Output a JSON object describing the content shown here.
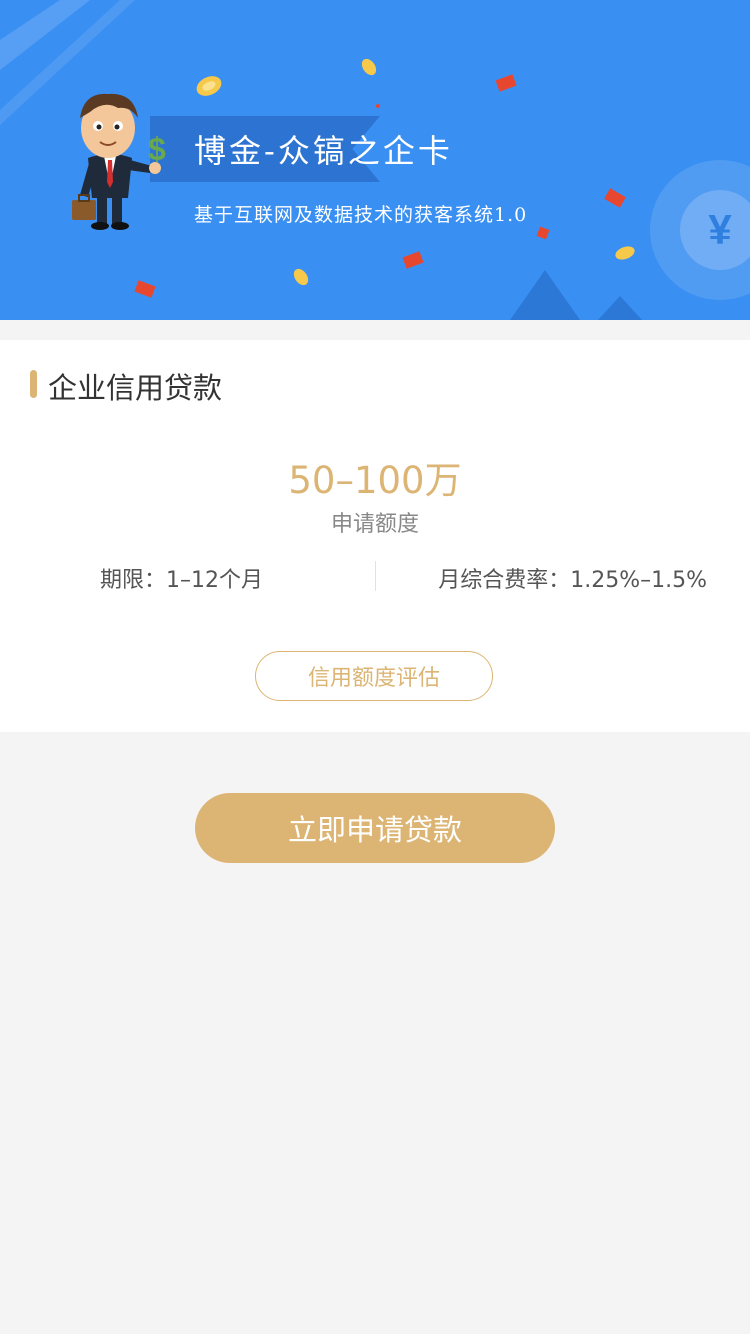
{
  "banner": {
    "title": "博金-众镐之企卡",
    "subtitle": "基于互联网及数据技术的获客系统1.0",
    "dollar_glyph": "$",
    "yen_glyph": "¥",
    "colors": {
      "background": "#3a8ff2",
      "ribbon": "#2d74d2"
    }
  },
  "product": {
    "title": "企业信用贷款",
    "amount": "50–100万",
    "amount_label": "申请额度",
    "term": "期限：1–12个月",
    "rate": "月综合费率：1.25%–1.5%",
    "evaluate_button": "信用额度评估"
  },
  "apply_button": "立即申请贷款",
  "colors": {
    "accent_gold": "#dcb574",
    "page_background": "#f4f4f4",
    "card_background": "#ffffff"
  }
}
